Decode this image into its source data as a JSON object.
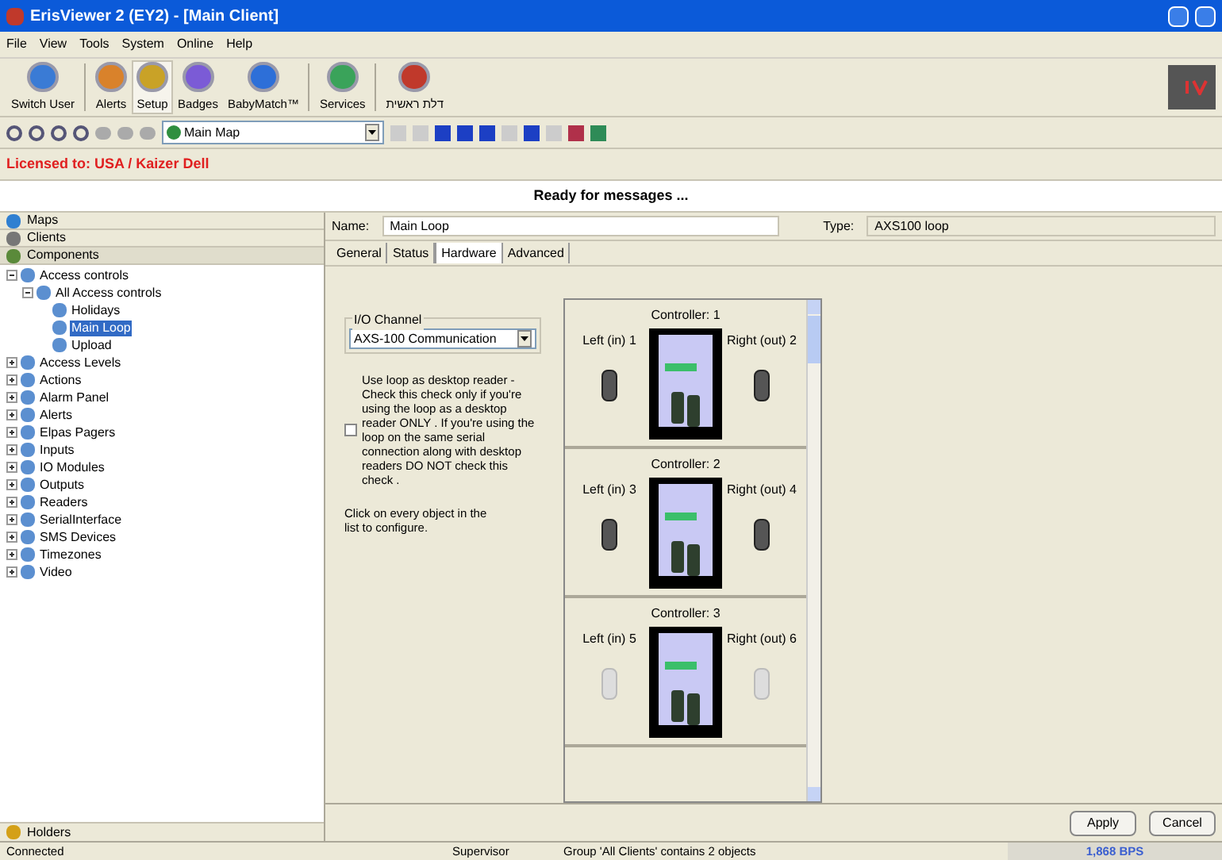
{
  "window": {
    "title": "ErisViewer 2 (EY2) - [Main Client]"
  },
  "menu": [
    "File",
    "View",
    "Tools",
    "System",
    "Online",
    "Help"
  ],
  "toolbar_groups": [
    {
      "buttons": [
        {
          "label": "Switch User",
          "selected": false
        }
      ]
    },
    {
      "buttons": [
        {
          "label": "Alerts",
          "selected": false
        },
        {
          "label": "Setup",
          "selected": true
        },
        {
          "label": "Badges",
          "selected": false
        },
        {
          "label": "BabyMatch™",
          "selected": false
        }
      ]
    },
    {
      "buttons": [
        {
          "label": "Services",
          "selected": false
        }
      ]
    },
    {
      "buttons": [
        {
          "label": "דלת ראשית",
          "selected": false
        }
      ]
    }
  ],
  "map_select": {
    "value": "Main Map"
  },
  "license": "Licensed to: USA / Kaizer Dell",
  "message": "Ready for messages ...",
  "sidebar": {
    "sections": [
      {
        "label": "Maps",
        "selected": false
      },
      {
        "label": "Clients",
        "selected": false
      },
      {
        "label": "Components",
        "selected": true
      }
    ],
    "tree": [
      {
        "label": "Access controls",
        "expanded": true,
        "selected": false,
        "children": [
          {
            "label": "All Access controls",
            "expanded": true,
            "selected": false,
            "children": [
              {
                "label": "Holidays",
                "selected": false
              },
              {
                "label": "Main Loop",
                "selected": true
              },
              {
                "label": "Upload",
                "selected": false
              }
            ]
          }
        ]
      },
      {
        "label": "Access Levels",
        "expanded": false,
        "selected": false
      },
      {
        "label": "Actions",
        "expanded": false,
        "selected": false
      },
      {
        "label": "Alarm Panel",
        "expanded": false,
        "selected": false
      },
      {
        "label": "Alerts",
        "expanded": false,
        "selected": false
      },
      {
        "label": "Elpas Pagers",
        "expanded": false,
        "selected": false
      },
      {
        "label": "Inputs",
        "expanded": false,
        "selected": false
      },
      {
        "label": "IO Modules",
        "expanded": false,
        "selected": false
      },
      {
        "label": "Outputs",
        "expanded": false,
        "selected": false
      },
      {
        "label": "Readers",
        "expanded": false,
        "selected": false
      },
      {
        "label": "SerialInterface",
        "expanded": false,
        "selected": false
      },
      {
        "label": "SMS Devices",
        "expanded": false,
        "selected": false
      },
      {
        "label": "Timezones",
        "expanded": false,
        "selected": false
      },
      {
        "label": "Video",
        "expanded": false,
        "selected": false
      }
    ],
    "bottom_section": {
      "label": "Holders"
    }
  },
  "detail": {
    "name_label": "Name:",
    "name_value": "Main Loop",
    "type_label": "Type:",
    "type_value": "AXS100 loop",
    "tabs": [
      {
        "label": "General",
        "selected": false
      },
      {
        "label": "Status",
        "selected": false
      },
      {
        "label": "Hardware",
        "selected": true
      },
      {
        "label": "Advanced",
        "selected": false
      }
    ],
    "io_channel": {
      "label": "I/O Channel",
      "value": "AXS-100 Communication"
    },
    "desktop_reader": {
      "checked": false,
      "text": "Use loop as desktop reader - Check this check only if you're using the loop as a desktop reader ONLY .  If you're using the loop on the same serial connection along with desktop readers DO NOT check this check ."
    },
    "hint": "Click on every object in the list to configure.",
    "controllers": [
      {
        "title": "Controller: 1",
        "left": {
          "label": "Left (in) 1",
          "active": true
        },
        "right": {
          "label": "Right (out) 2",
          "active": true
        }
      },
      {
        "title": "Controller: 2",
        "left": {
          "label": "Left (in) 3",
          "active": true
        },
        "right": {
          "label": "Right (out) 4",
          "active": true
        }
      },
      {
        "title": "Controller: 3",
        "left": {
          "label": "Left (in) 5",
          "active": false
        },
        "right": {
          "label": "Right (out) 6",
          "active": false
        }
      }
    ],
    "buttons": [
      "Apply",
      "Cancel"
    ]
  },
  "status_bar": {
    "connection": "Connected",
    "user": "Supervisor",
    "info": "Group 'All Clients' contains 2 objects",
    "rate": "1,868 BPS"
  }
}
